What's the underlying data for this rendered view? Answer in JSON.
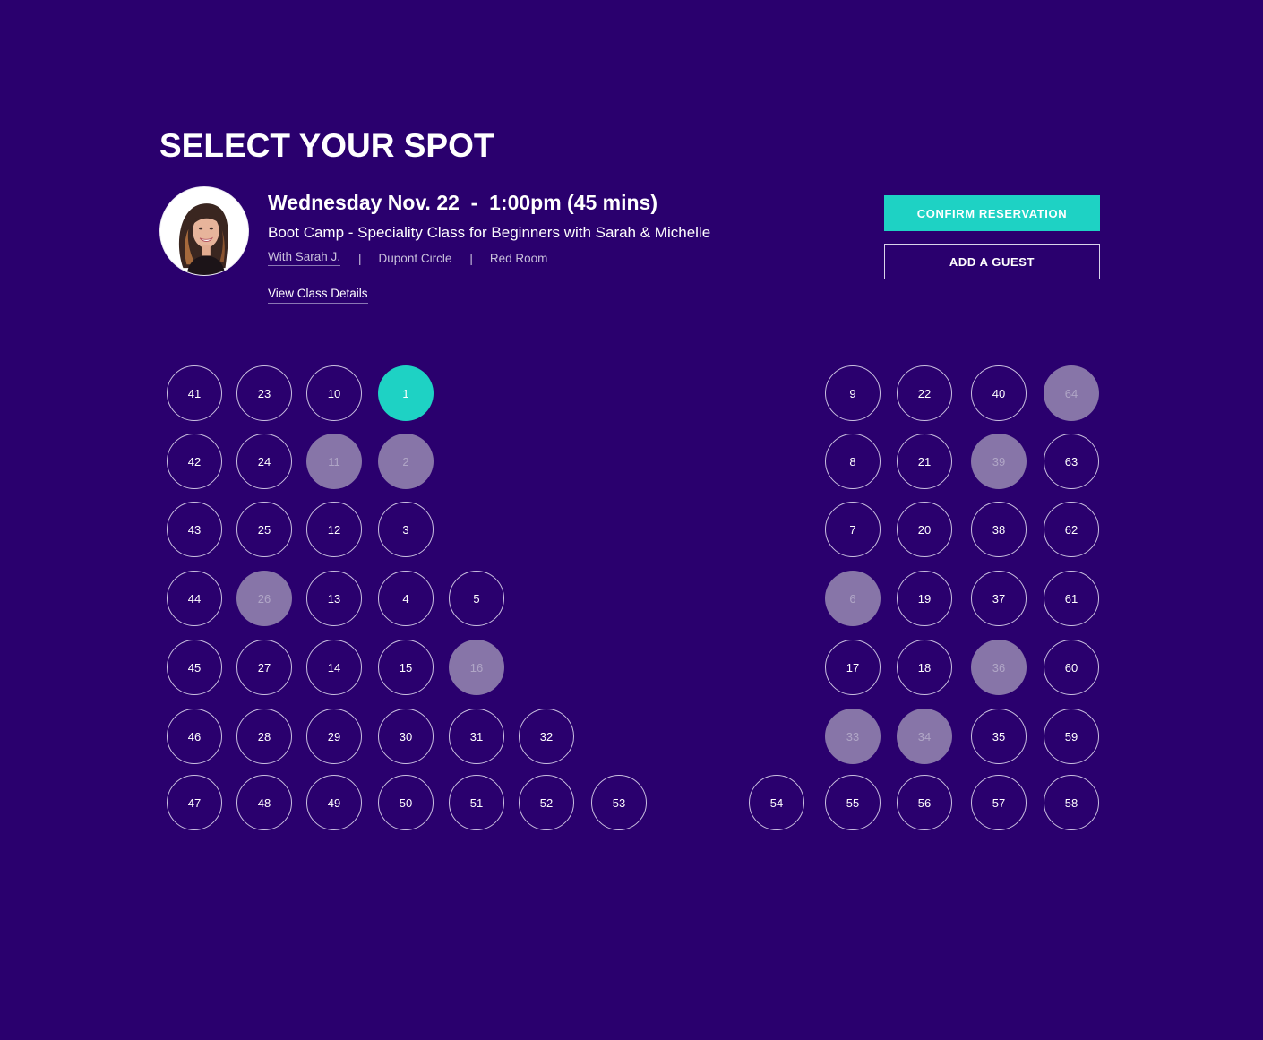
{
  "page": {
    "title": "SELECT YOUR SPOT"
  },
  "class_info": {
    "date_time": "Wednesday Nov. 22  -  1:00pm (45 mins)",
    "name": "Boot Camp - Speciality Class for Beginners with Sarah & Michelle",
    "instructor_link": "With Sarah J.",
    "separator": "|",
    "location": "Dupont Circle",
    "room": "Red Room",
    "view_details_label": "View Class Details",
    "avatar_icon": "instructor-photo"
  },
  "actions": {
    "confirm_label": "CONFIRM RESERVATION",
    "guest_label": "ADD A GUEST"
  },
  "colors": {
    "background": "#2a006e",
    "accent": "#1ed2c4",
    "taken": "#8775a8",
    "available_border": "#c9bfe0"
  },
  "seat_map": {
    "legend_states": [
      "available",
      "taken",
      "selected"
    ],
    "seats": [
      {
        "number": "41",
        "row": 0,
        "col": 0,
        "state": "available"
      },
      {
        "number": "23",
        "row": 0,
        "col": 1,
        "state": "available"
      },
      {
        "number": "10",
        "row": 0,
        "col": 2,
        "state": "available"
      },
      {
        "number": "1",
        "row": 0,
        "col": 3,
        "state": "selected"
      },
      {
        "number": "9",
        "row": 0,
        "col": 9,
        "state": "available"
      },
      {
        "number": "22",
        "row": 0,
        "col": 10,
        "state": "available"
      },
      {
        "number": "40",
        "row": 0,
        "col": 11,
        "state": "available"
      },
      {
        "number": "64",
        "row": 0,
        "col": 12,
        "state": "taken"
      },
      {
        "number": "42",
        "row": 1,
        "col": 0,
        "state": "available"
      },
      {
        "number": "24",
        "row": 1,
        "col": 1,
        "state": "available"
      },
      {
        "number": "11",
        "row": 1,
        "col": 2,
        "state": "taken"
      },
      {
        "number": "2",
        "row": 1,
        "col": 3,
        "state": "taken"
      },
      {
        "number": "8",
        "row": 1,
        "col": 9,
        "state": "available"
      },
      {
        "number": "21",
        "row": 1,
        "col": 10,
        "state": "available"
      },
      {
        "number": "39",
        "row": 1,
        "col": 11,
        "state": "taken"
      },
      {
        "number": "63",
        "row": 1,
        "col": 12,
        "state": "available"
      },
      {
        "number": "43",
        "row": 2,
        "col": 0,
        "state": "available"
      },
      {
        "number": "25",
        "row": 2,
        "col": 1,
        "state": "available"
      },
      {
        "number": "12",
        "row": 2,
        "col": 2,
        "state": "available"
      },
      {
        "number": "3",
        "row": 2,
        "col": 3,
        "state": "available"
      },
      {
        "number": "7",
        "row": 2,
        "col": 9,
        "state": "available"
      },
      {
        "number": "20",
        "row": 2,
        "col": 10,
        "state": "available"
      },
      {
        "number": "38",
        "row": 2,
        "col": 11,
        "state": "available"
      },
      {
        "number": "62",
        "row": 2,
        "col": 12,
        "state": "available"
      },
      {
        "number": "44",
        "row": 3,
        "col": 0,
        "state": "available"
      },
      {
        "number": "26",
        "row": 3,
        "col": 1,
        "state": "taken"
      },
      {
        "number": "13",
        "row": 3,
        "col": 2,
        "state": "available"
      },
      {
        "number": "4",
        "row": 3,
        "col": 3,
        "state": "available"
      },
      {
        "number": "5",
        "row": 3,
        "col": 4,
        "state": "available"
      },
      {
        "number": "6",
        "row": 3,
        "col": 9,
        "state": "taken"
      },
      {
        "number": "19",
        "row": 3,
        "col": 10,
        "state": "available"
      },
      {
        "number": "37",
        "row": 3,
        "col": 11,
        "state": "available"
      },
      {
        "number": "61",
        "row": 3,
        "col": 12,
        "state": "available"
      },
      {
        "number": "45",
        "row": 4,
        "col": 0,
        "state": "available"
      },
      {
        "number": "27",
        "row": 4,
        "col": 1,
        "state": "available"
      },
      {
        "number": "14",
        "row": 4,
        "col": 2,
        "state": "available"
      },
      {
        "number": "15",
        "row": 4,
        "col": 3,
        "state": "available"
      },
      {
        "number": "16",
        "row": 4,
        "col": 4,
        "state": "taken"
      },
      {
        "number": "17",
        "row": 4,
        "col": 9,
        "state": "available"
      },
      {
        "number": "18",
        "row": 4,
        "col": 10,
        "state": "available"
      },
      {
        "number": "36",
        "row": 4,
        "col": 11,
        "state": "taken"
      },
      {
        "number": "60",
        "row": 4,
        "col": 12,
        "state": "available"
      },
      {
        "number": "46",
        "row": 5,
        "col": 0,
        "state": "available"
      },
      {
        "number": "28",
        "row": 5,
        "col": 1,
        "state": "available"
      },
      {
        "number": "29",
        "row": 5,
        "col": 2,
        "state": "available"
      },
      {
        "number": "30",
        "row": 5,
        "col": 3,
        "state": "available"
      },
      {
        "number": "31",
        "row": 5,
        "col": 4,
        "state": "available"
      },
      {
        "number": "32",
        "row": 5,
        "col": 5,
        "state": "available"
      },
      {
        "number": "33",
        "row": 5,
        "col": 9,
        "state": "taken"
      },
      {
        "number": "34",
        "row": 5,
        "col": 10,
        "state": "taken"
      },
      {
        "number": "35",
        "row": 5,
        "col": 11,
        "state": "available"
      },
      {
        "number": "59",
        "row": 5,
        "col": 12,
        "state": "available"
      },
      {
        "number": "47",
        "row": 6,
        "col": 0,
        "state": "available"
      },
      {
        "number": "48",
        "row": 6,
        "col": 1,
        "state": "available"
      },
      {
        "number": "49",
        "row": 6,
        "col": 2,
        "state": "available"
      },
      {
        "number": "50",
        "row": 6,
        "col": 3,
        "state": "available"
      },
      {
        "number": "51",
        "row": 6,
        "col": 4,
        "state": "available"
      },
      {
        "number": "52",
        "row": 6,
        "col": 5,
        "state": "available"
      },
      {
        "number": "53",
        "row": 6,
        "col": 6,
        "state": "available"
      },
      {
        "number": "54",
        "row": 6,
        "col": 8,
        "state": "available"
      },
      {
        "number": "55",
        "row": 6,
        "col": 9,
        "state": "available"
      },
      {
        "number": "56",
        "row": 6,
        "col": 10,
        "state": "available"
      },
      {
        "number": "57",
        "row": 6,
        "col": 11,
        "state": "available"
      },
      {
        "number": "58",
        "row": 6,
        "col": 12,
        "state": "available"
      }
    ]
  }
}
